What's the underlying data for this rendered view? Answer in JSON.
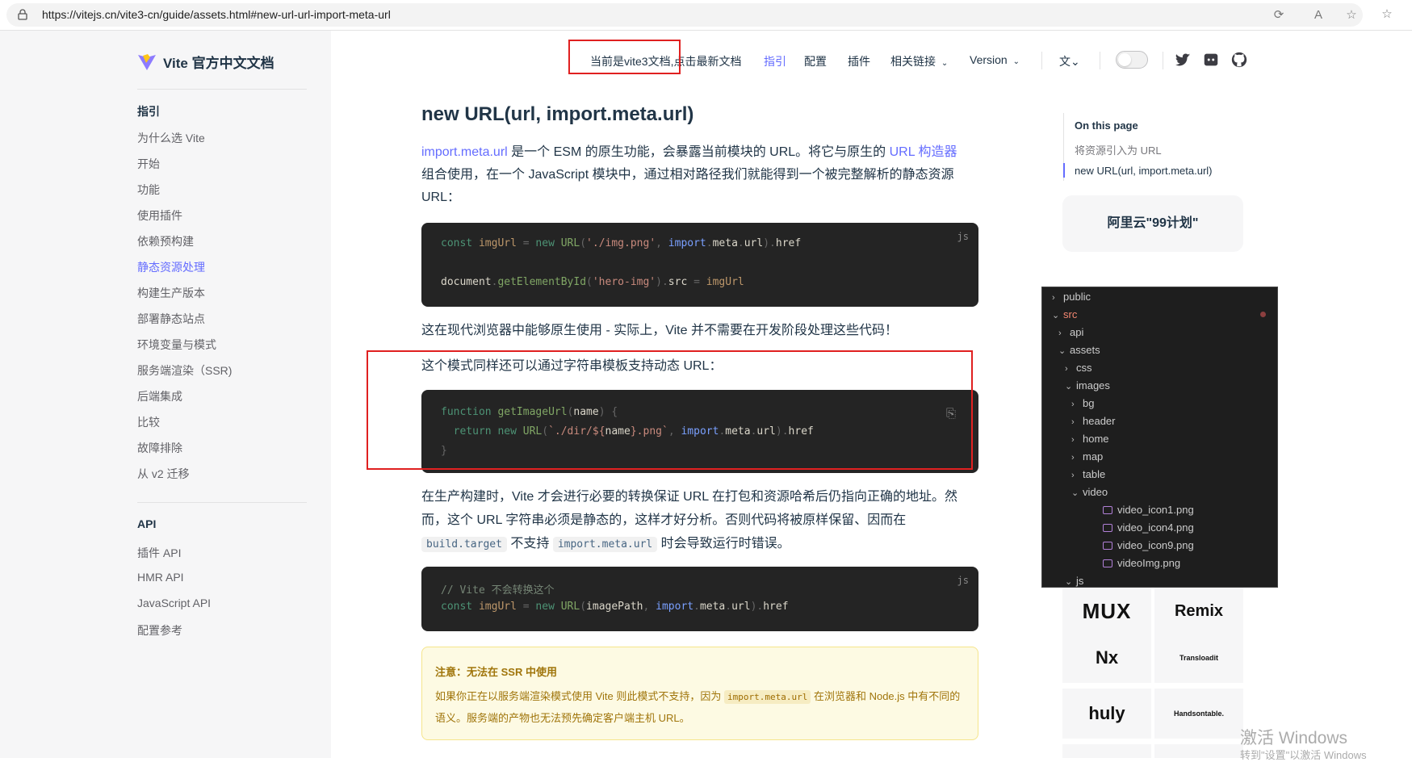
{
  "browser": {
    "url": "https://vitejs.cn/vite3-cn/guide/assets.html#new-url-url-import-meta-url"
  },
  "sidebar": {
    "brand": "Vite 官方中文文档",
    "group1_title": "指引",
    "group1_items": [
      "为什么选 Vite",
      "开始",
      "功能",
      "使用插件",
      "依赖预构建",
      "静态资源处理",
      "构建生产版本",
      "部署静态站点",
      "环境变量与模式",
      "服务端渲染（SSR)",
      "后端集成",
      "比较",
      "故障排除",
      "从 v2 迁移"
    ],
    "active_item": "静态资源处理",
    "group2_title": "API",
    "group2_items": [
      "插件 API",
      "HMR API",
      "JavaScript API",
      "配置参考"
    ]
  },
  "nav": {
    "notice": "当前是vite3文档,点击最新文档",
    "guide": "指引",
    "config": "配置",
    "plugins": "插件",
    "links": "相关链接",
    "version": "Version"
  },
  "content": {
    "heading": "new URL(url, import.meta.url)",
    "p1_link1": "import.meta.url",
    "p1_text1": " 是一个 ESM 的原生功能，会暴露当前模块的 URL。将它与原生的 ",
    "p1_link2": "URL 构造器",
    "p1_text2": "组合使用，在一个 JavaScript 模块中，通过相对路径我们就能得到一个被完整解析的静态资源 URL：",
    "code1_lang": "js",
    "p2": "这在现代浏览器中能够原生使用 - 实际上，Vite 并不需要在开发阶段处理这些代码！",
    "p3": "这个模式同样还可以通过字符串模板支持动态 URL：",
    "p4_text1": "在生产构建时，Vite 才会进行必要的转换保证 URL 在打包和资源哈希后仍指向正确的地址。然而，这个 URL 字符串必须是静态的，这样才好分析。否则代码将被原样保留、因而在 ",
    "p4_code1": "build.target",
    "p4_text2": " 不支持 ",
    "p4_code2": "import.meta.url",
    "p4_text3": " 时会导致运行时错误。",
    "code3_lang": "js",
    "code3_comment": "// Vite 不会转换这个",
    "warn_title": "注意：无法在 SSR 中使用",
    "warn_text1": "如果你正在以服务端渲染模式使用 Vite 则此模式不支持，因为 ",
    "warn_code": "import.meta.url",
    "warn_text2": " 在浏览器和 Node.js 中有不同的语义。服务端的产物也无法预先确定客户端主机 URL。"
  },
  "aside": {
    "toc_title": "On this page",
    "toc_items": [
      "将资源引入为 URL",
      "new URL(url, import.meta.url)"
    ],
    "ad": "阿里云\"99计划\"",
    "sponsors": [
      "MUX",
      "Remix",
      "Nx",
      "Transloadit",
      "huly",
      "Handsontable."
    ]
  },
  "file_tree": [
    {
      "name": "public",
      "depth": 0,
      "kind": "folder",
      "open": false
    },
    {
      "name": "src",
      "depth": 0,
      "kind": "folder",
      "open": true,
      "color": "#f48771"
    },
    {
      "name": "api",
      "depth": 1,
      "kind": "folder",
      "open": false
    },
    {
      "name": "assets",
      "depth": 1,
      "kind": "folder",
      "open": true
    },
    {
      "name": "css",
      "depth": 2,
      "kind": "folder",
      "open": false
    },
    {
      "name": "images",
      "depth": 2,
      "kind": "folder",
      "open": true
    },
    {
      "name": "bg",
      "depth": 3,
      "kind": "folder",
      "open": false
    },
    {
      "name": "header",
      "depth": 3,
      "kind": "folder",
      "open": false
    },
    {
      "name": "home",
      "depth": 3,
      "kind": "folder",
      "open": false
    },
    {
      "name": "map",
      "depth": 3,
      "kind": "folder",
      "open": false
    },
    {
      "name": "table",
      "depth": 3,
      "kind": "folder",
      "open": false
    },
    {
      "name": "video",
      "depth": 3,
      "kind": "folder",
      "open": true
    },
    {
      "name": "video_icon1.png",
      "depth": 4,
      "kind": "image"
    },
    {
      "name": "video_icon4.png",
      "depth": 4,
      "kind": "image"
    },
    {
      "name": "video_icon9.png",
      "depth": 4,
      "kind": "image"
    },
    {
      "name": "videoImg.png",
      "depth": 4,
      "kind": "image"
    },
    {
      "name": "js",
      "depth": 2,
      "kind": "folder",
      "open": true
    }
  ],
  "watermark": {
    "line1": "激活 Windows",
    "line2": "转到\"设置\"以激活 Windows"
  },
  "colors": {
    "accent": "#646cff",
    "highlight": "#e02020",
    "code_bg": "#242424",
    "warning_bg": "#fdfae3"
  }
}
